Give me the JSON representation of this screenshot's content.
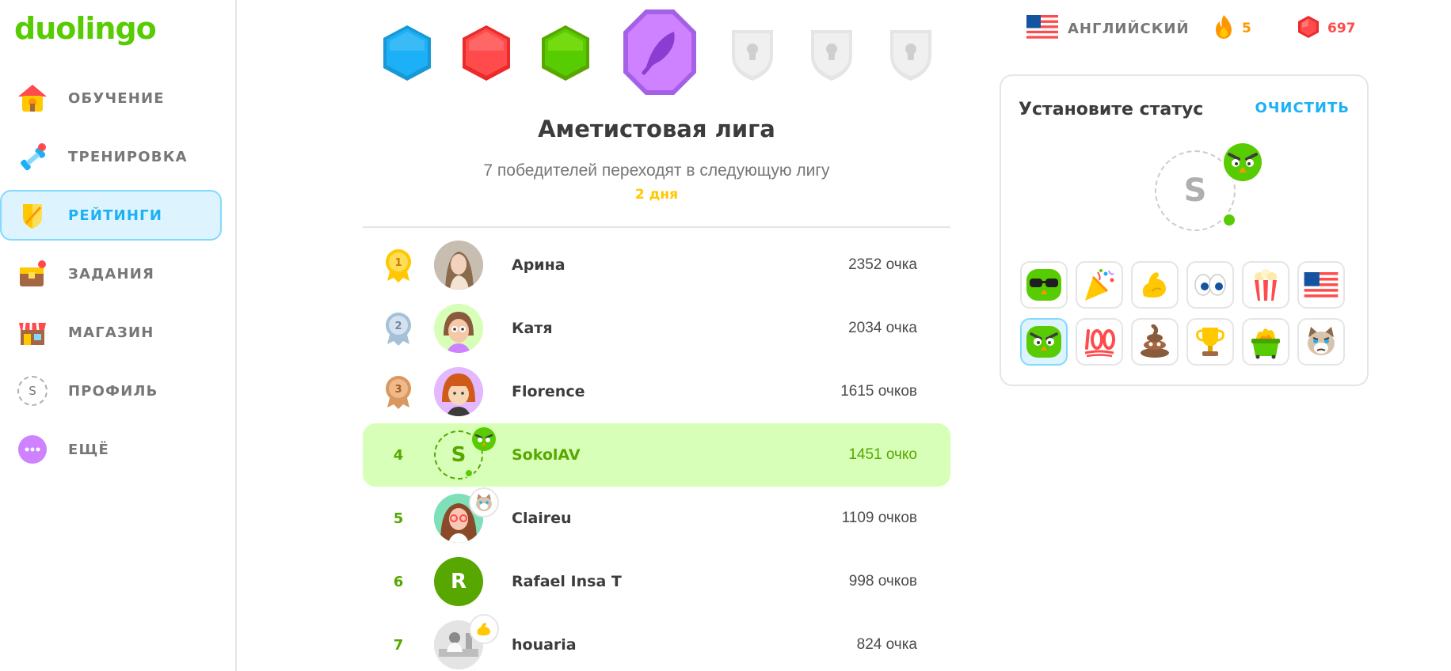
{
  "brand": {
    "logo_text": "duolingo",
    "color": "#58cc02"
  },
  "sidebar": {
    "items": [
      {
        "label": "ОБУЧЕНИЕ",
        "icon": "home-icon"
      },
      {
        "label": "ТРЕНИРОВКА",
        "icon": "dumbbell-icon"
      },
      {
        "label": "РЕЙТИНГИ",
        "icon": "shield-icon",
        "active": true
      },
      {
        "label": "ЗАДАНИЯ",
        "icon": "chest-icon"
      },
      {
        "label": "МАГАЗИН",
        "icon": "shop-icon"
      },
      {
        "label": "ПРОФИЛЬ",
        "icon": "profile-icon",
        "avatar_letter": "S"
      },
      {
        "label": "ЕЩЁ",
        "icon": "more-icon"
      }
    ]
  },
  "league": {
    "title": "Аметистовая лига",
    "subtitle": "7 победителей переходят в следующую лигу",
    "time_left": "2 дня",
    "badges": [
      "sapphire",
      "ruby",
      "emerald",
      "amethyst",
      "locked",
      "locked",
      "locked"
    ]
  },
  "leaderboard": [
    {
      "rank": "1",
      "name": "Арина",
      "xp": "2352 очка",
      "avatar": "photo"
    },
    {
      "rank": "2",
      "name": "Катя",
      "xp": "2034 очка",
      "avatar": "cartoon-girl"
    },
    {
      "rank": "3",
      "name": "Florence",
      "xp": "1615 очков",
      "avatar": "cartoon-redhead"
    },
    {
      "rank": "4",
      "name": "SokolAV",
      "xp": "1451 очко",
      "avatar": "letter",
      "letter": "S",
      "me": true
    },
    {
      "rank": "5",
      "name": "Claireu",
      "xp": "1109 очков",
      "avatar": "cartoon-glasses"
    },
    {
      "rank": "6",
      "name": "Rafael Insa T",
      "xp": "998 очков",
      "avatar": "letter",
      "letter": "R"
    },
    {
      "rank": "7",
      "name": "houaria",
      "xp": "824 очка",
      "avatar": "photo-lab"
    }
  ],
  "topbar": {
    "language": "АНГЛИЙСКИЙ",
    "streak": "5",
    "gems": "697"
  },
  "status": {
    "title": "Установите статус",
    "clear_label": "ОЧИСТИТЬ",
    "avatar_letter": "S",
    "emojis": [
      "sunglasses-owl",
      "party-popper",
      "flexed-biceps",
      "eyes",
      "popcorn",
      "us-flag",
      "angry-owl",
      "hundred-points",
      "poop",
      "trophy",
      "dumpster-fire",
      "grumpy-cat"
    ]
  },
  "colors": {
    "accent_blue": "#1cb0f6",
    "active_bg": "#ddf4ff",
    "me_row": "#d7ffb8",
    "streak": "#ff9600",
    "gems": "#ff4b4b",
    "timer": "#ffc800"
  }
}
